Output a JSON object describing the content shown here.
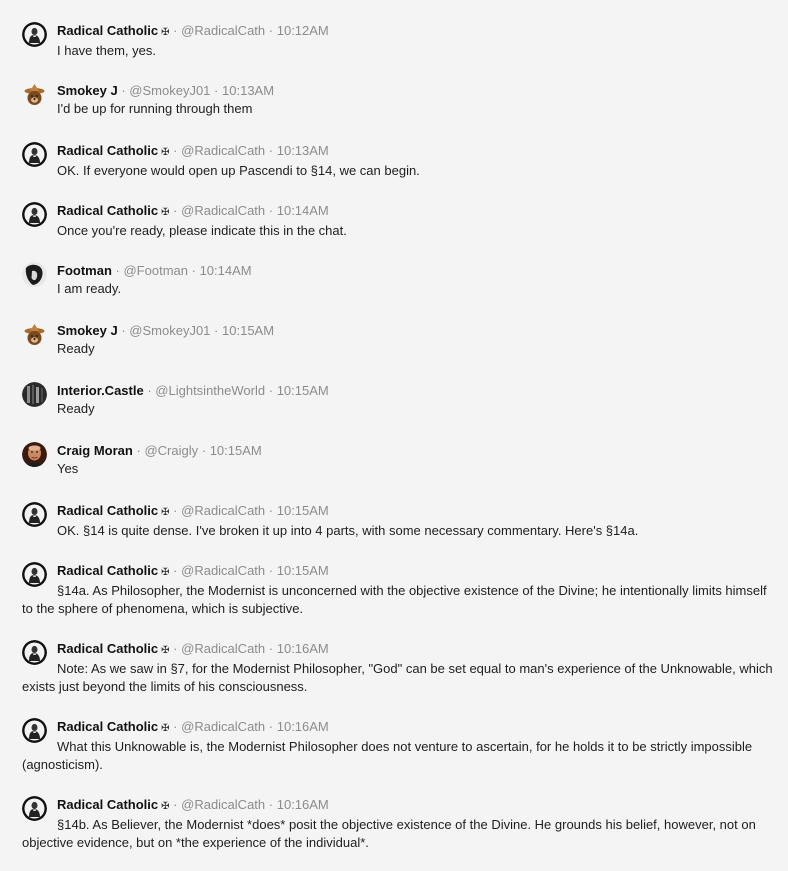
{
  "sep": "·",
  "messages": [
    {
      "name": "Radical Catholic",
      "badge": "✠",
      "handle": "@RadicalCath",
      "time": "10:12AM",
      "avatar": "priest",
      "text": "I have them, yes."
    },
    {
      "name": "Smokey J",
      "badge": "",
      "handle": "@SmokeyJ01",
      "time": "10:13AM",
      "avatar": "bear",
      "text": "I'd be up for running through them"
    },
    {
      "name": "Radical Catholic",
      "badge": "✠",
      "handle": "@RadicalCath",
      "time": "10:13AM",
      "avatar": "priest",
      "text": "OK. If everyone would open up Pascendi to §14, we can begin."
    },
    {
      "name": "Radical Catholic",
      "badge": "✠",
      "handle": "@RadicalCath",
      "time": "10:14AM",
      "avatar": "priest",
      "text": "Once you're ready, please indicate this in the chat."
    },
    {
      "name": "Footman",
      "badge": "",
      "handle": "@Footman",
      "time": "10:14AM",
      "avatar": "footman",
      "text": "I am ready."
    },
    {
      "name": "Smokey J",
      "badge": "",
      "handle": "@SmokeyJ01",
      "time": "10:15AM",
      "avatar": "bear",
      "text": "Ready"
    },
    {
      "name": "Interior.Castle",
      "badge": "",
      "handle": "@LightsintheWorld",
      "time": "10:15AM",
      "avatar": "castle",
      "text": "Ready"
    },
    {
      "name": "Craig Moran",
      "badge": "",
      "handle": "@Craigly",
      "time": "10:15AM",
      "avatar": "craig",
      "text": "Yes"
    },
    {
      "name": "Radical Catholic",
      "badge": "✠",
      "handle": "@RadicalCath",
      "time": "10:15AM",
      "avatar": "priest",
      "text": "OK. §14 is quite dense. I've broken it up into 4 parts, with some necessary commentary. Here's §14a."
    },
    {
      "name": "Radical Catholic",
      "badge": "✠",
      "handle": "@RadicalCath",
      "time": "10:15AM",
      "avatar": "priest",
      "text": "§14a. As Philosopher, the Modernist is unconcerned with the objective existence of the Divine; he intentionally limits himself to the sphere of phenomena, which is subjective."
    },
    {
      "name": "Radical Catholic",
      "badge": "✠",
      "handle": "@RadicalCath",
      "time": "10:16AM",
      "avatar": "priest",
      "text": "Note: As we saw in §7, for the Modernist Philosopher, \"God\" can be set equal to man's experience of the Unknowable, which exists just beyond the limits of his consciousness."
    },
    {
      "name": "Radical Catholic",
      "badge": "✠",
      "handle": "@RadicalCath",
      "time": "10:16AM",
      "avatar": "priest",
      "text": "What this Unknowable is, the Modernist Philosopher does not venture to ascertain, for he holds it to be strictly impossible (agnosticism)."
    },
    {
      "name": "Radical Catholic",
      "badge": "✠",
      "handle": "@RadicalCath",
      "time": "10:16AM",
      "avatar": "priest",
      "text": "§14b. As Believer, the Modernist *does* posit the objective existence of the Divine. He grounds his belief, however, not on objective evidence, but on *the experience of the individual*."
    }
  ]
}
